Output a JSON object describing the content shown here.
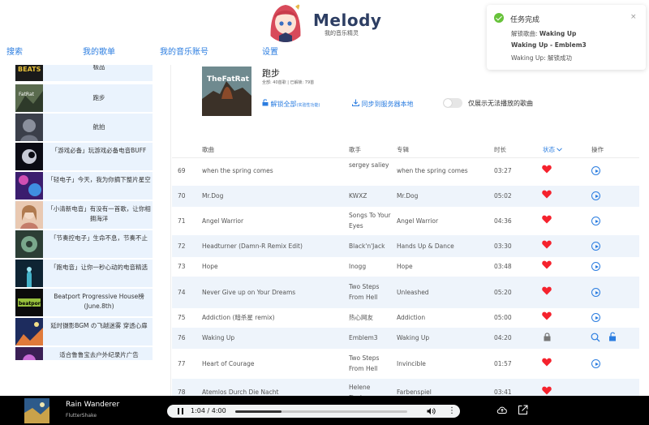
{
  "app": {
    "title": "Melody",
    "subtitle": "我的音乐精灵"
  },
  "nav": [
    "搜索",
    "我的歌单",
    "我的音乐账号",
    "设置"
  ],
  "playlists": [
    {
      "label": "极品"
    },
    {
      "label": "跑步"
    },
    {
      "label": "航拍"
    },
    {
      "label": "「游戏必备」玩游戏必备电音BUFF"
    },
    {
      "label": "「轻电子」今天，我为你摘下整片星空"
    },
    {
      "label": "「小清新电音」有没有一首歌，让你相拥海洋"
    },
    {
      "label": "「节奏控电子」生命不息，节奏不止"
    },
    {
      "label": "「跑电音」让你一秒心动的电音精选"
    },
    {
      "label": "Beatport Progressive House榜(June.8th)"
    },
    {
      "label": "延时摄影BGM の飞越迷雾 穿透心扉"
    },
    {
      "label": "适合鲁鲁宝去户外纪录片广告"
    }
  ],
  "album": {
    "title": "跑步",
    "meta": "全部: 40首歌 | 已解锁: 79首",
    "actions": {
      "unlock_all": "解锁全部",
      "unlock_note": "(实验性功能)",
      "sync": "同步到服务器本地",
      "toggle_label": "仅展示无法播放的歌曲"
    }
  },
  "columns": {
    "song": "歌曲",
    "artist": "歌手",
    "album": "专辑",
    "duration": "时长",
    "status": "状态",
    "action": "操作"
  },
  "rows": [
    {
      "num": "69",
      "song": "when the spring comes",
      "artist": "sergey saliey",
      "album": "when the spring comes",
      "duration": "03:27",
      "status": "liked"
    },
    {
      "num": "70",
      "song": "Mr.Dog",
      "artist": "KWXZ",
      "album": "Mr.Dog",
      "duration": "05:02",
      "status": "liked"
    },
    {
      "num": "71",
      "song": "Angel Warrior",
      "artist": "Songs To Your Eyes",
      "album": "Angel Warrior",
      "duration": "04:36",
      "status": "liked"
    },
    {
      "num": "72",
      "song": "Headturner (Damn-R Remix Edit)",
      "artist": "Black'n'Jack",
      "album": "Hands Up & Dance",
      "duration": "03:30",
      "status": "liked"
    },
    {
      "num": "73",
      "song": "Hope",
      "artist": "Inogg",
      "album": "Hope",
      "duration": "03:48",
      "status": "liked"
    },
    {
      "num": "74",
      "song": "Never Give up on Your Dreams",
      "artist": "Two Steps From Hell",
      "album": "Unleashed",
      "duration": "05:20",
      "status": "liked"
    },
    {
      "num": "75",
      "song": "Addiction (暗杀星 remix)",
      "artist": "热心网友",
      "album": "Addiction",
      "duration": "05:00",
      "status": "liked"
    },
    {
      "num": "76",
      "song": "Waking Up",
      "artist": "Emblem3",
      "album": "Waking Up",
      "duration": "04:20",
      "status": "locked"
    },
    {
      "num": "77",
      "song": "Heart of Courage",
      "artist": "Two Steps From Hell",
      "album": "Invincible",
      "duration": "01:57",
      "status": "liked"
    },
    {
      "num": "78",
      "song": "Atemlos Durch Die Nacht",
      "artist": "Helene Fischer",
      "album": "Farbenspiel",
      "duration": "03:41",
      "status": "liked"
    }
  ],
  "toast": {
    "title": "任务完成",
    "line1_label": "解锁歌曲:",
    "line1_value": "Waking Up",
    "line2": "Waking Up - Emblem3",
    "line3": "Waking Up: 解锁成功",
    "close": "×"
  },
  "player": {
    "song": "Rain Wanderer",
    "artist": "FlutterShake",
    "time": "1:04 / 4:00",
    "progress": 0.27
  },
  "colors": {
    "accent": "#2b7de0",
    "heart": "#f5222d",
    "row_alt": "#eef4fb",
    "success": "#67c23a"
  }
}
